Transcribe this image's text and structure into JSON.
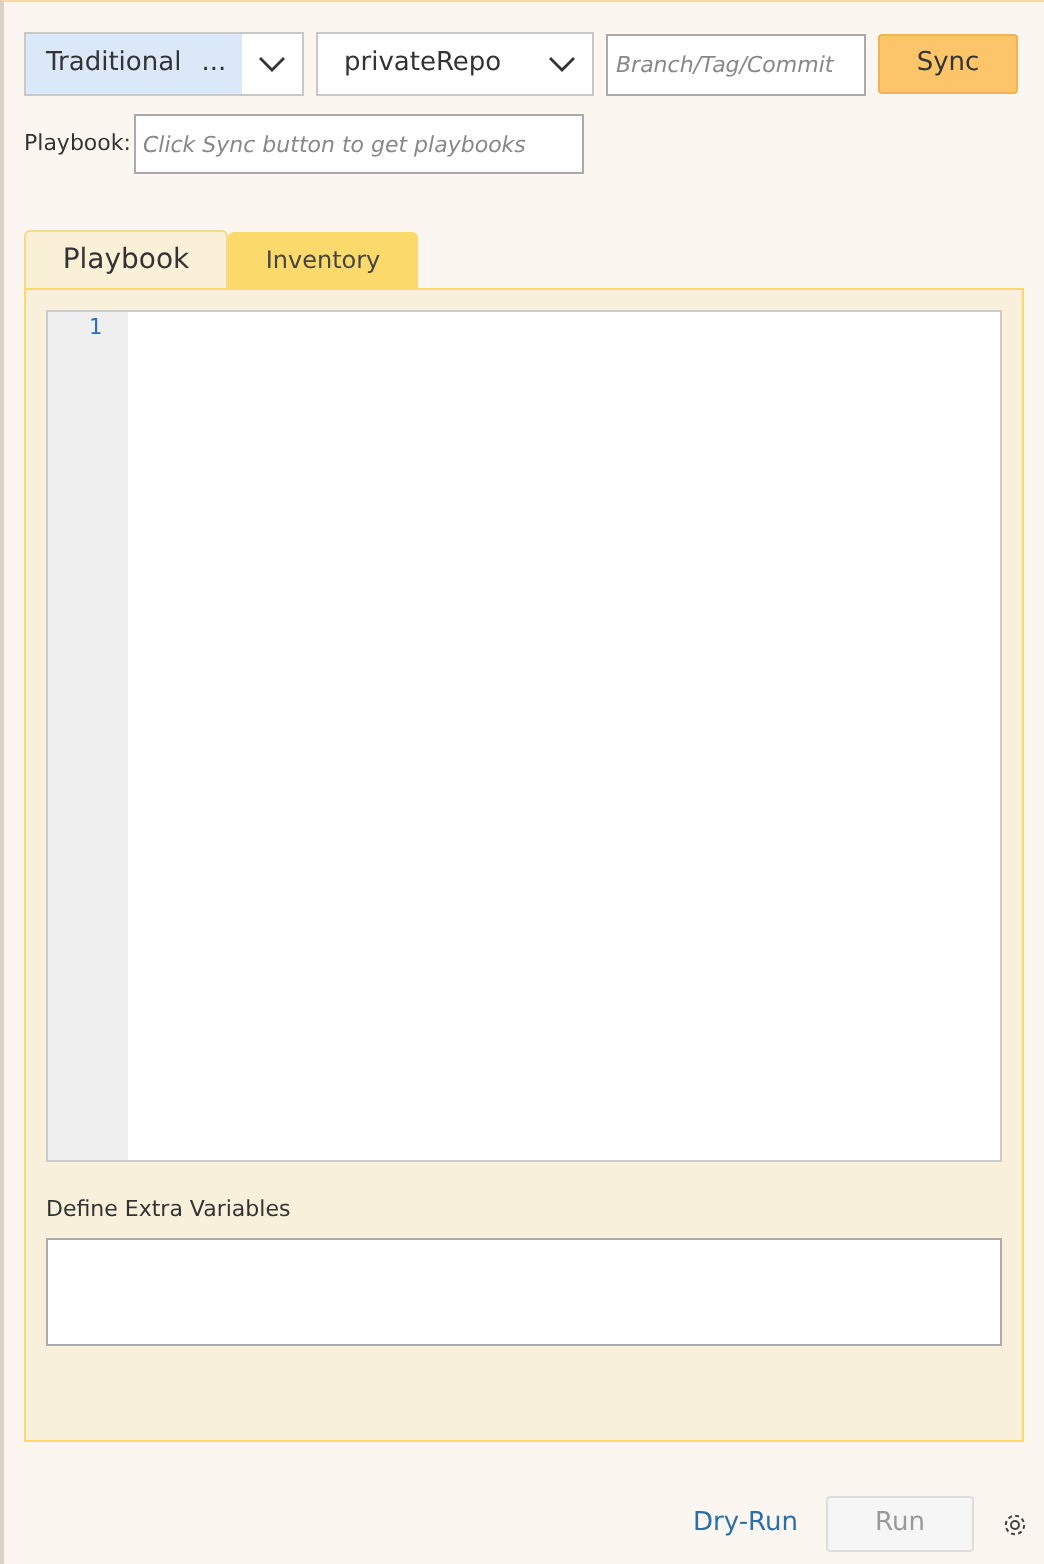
{
  "toolbar": {
    "mode_select": {
      "value": "Traditional",
      "ellipsis": "..."
    },
    "repo_select": {
      "value": "privateRepo"
    },
    "ref_field": {
      "placeholder": "Branch/Tag/Commit"
    },
    "sync_button": "Sync"
  },
  "playbook_field": {
    "label": "Playbook:",
    "placeholder": "Click Sync button to get playbooks"
  },
  "tabs": [
    {
      "label": "Playbook",
      "selected": true
    },
    {
      "label": "Inventory",
      "selected": false
    }
  ],
  "editor": {
    "line_numbers": [
      "1"
    ]
  },
  "extra_variables": {
    "label": "Define Extra Variables"
  },
  "footer": {
    "dry_run_link": "Dry-Run",
    "run_button": {
      "label": "Run",
      "disabled": true
    }
  }
}
